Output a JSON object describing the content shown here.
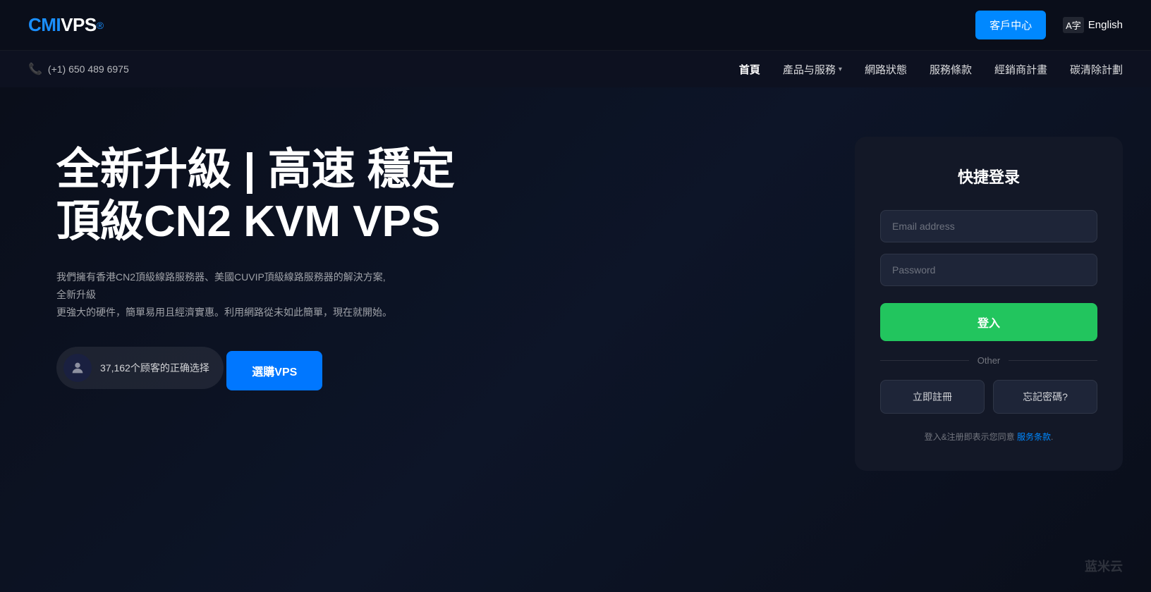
{
  "header": {
    "logo": {
      "cmi": "CMI",
      "vps": "VPS",
      "sup": "®"
    },
    "client_center_label": "客戶中心",
    "language": {
      "icon_text": "A字",
      "label": "English"
    }
  },
  "navbar": {
    "phone": {
      "icon": "📞",
      "number": "(+1) 650 489 6975"
    },
    "links": [
      {
        "id": "home",
        "label": "首頁",
        "active": true
      },
      {
        "id": "products",
        "label": "產品与服務",
        "has_arrow": true
      },
      {
        "id": "network",
        "label": "網路狀態"
      },
      {
        "id": "terms",
        "label": "服務條款"
      },
      {
        "id": "reseller",
        "label": "經銷商計畫"
      },
      {
        "id": "carbon",
        "label": "碳清除計劃"
      }
    ]
  },
  "hero": {
    "title_line1": "全新升級 | 高速 穩定",
    "title_line2": "頂級CN2 KVM VPS",
    "description": "我們擁有香港CN2頂級線路服務器、美國CUVIP頂級線路服務器的解決方案, 全新升級\n更強大的硬件，簡單易用且經濟實惠。利用網路從未如此簡單，現在就開始。",
    "customer_badge": {
      "icon": "👤",
      "text": "37,162个顾客的正确选择"
    },
    "cta_button": "選購VPS"
  },
  "login_form": {
    "title": "快捷登录",
    "email_placeholder": "Email address",
    "password_placeholder": "Password",
    "login_button": "登入",
    "divider_label": "Other",
    "register_button": "立即註冊",
    "forgot_button": "忘記密碼?",
    "terms_prefix": "登入&注册即表示您同意 ",
    "terms_link": "服务条款",
    "terms_suffix": "."
  },
  "watermark": {
    "text": "蓝米云"
  }
}
